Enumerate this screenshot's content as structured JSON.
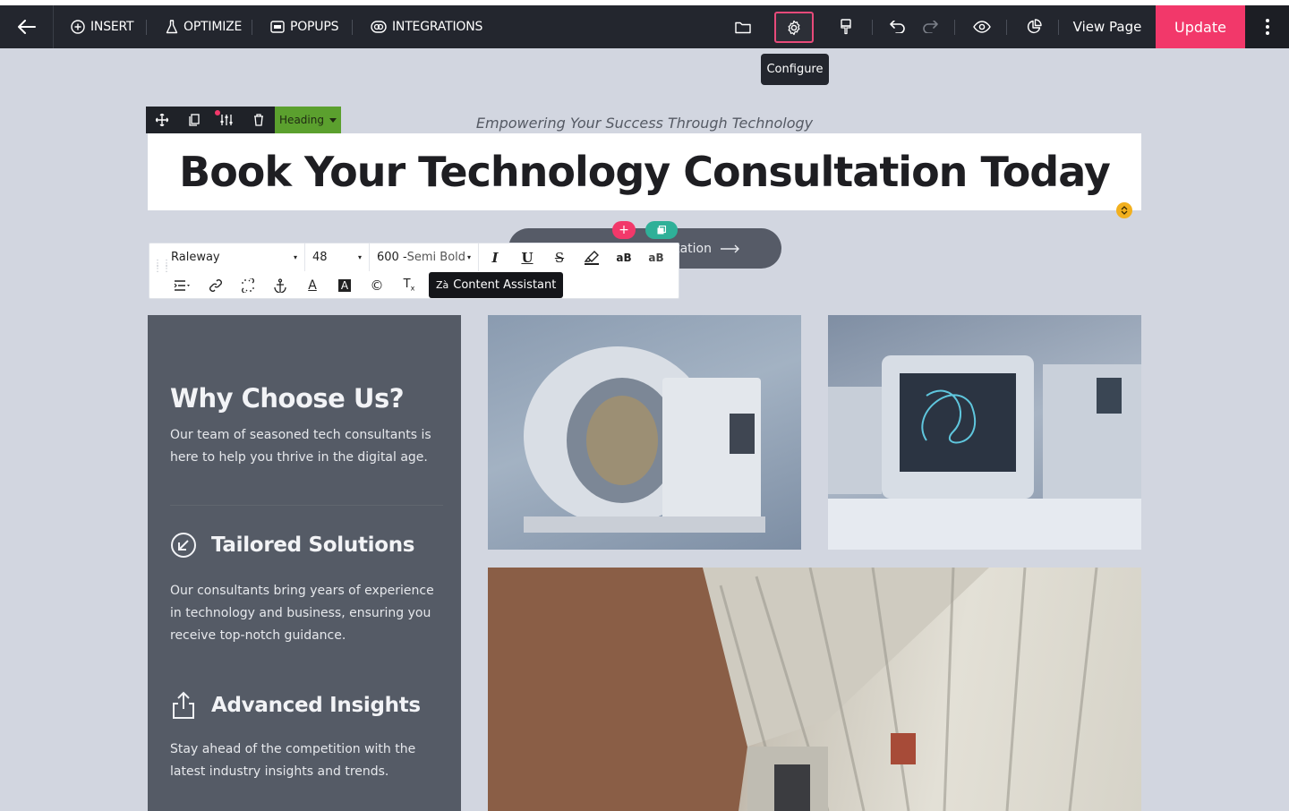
{
  "topbar": {
    "nav": [
      {
        "label": "INSERT",
        "icon": "plus-circle-icon"
      },
      {
        "label": "OPTIMIZE",
        "icon": "flask-icon"
      },
      {
        "label": "POPUPS",
        "icon": "popup-icon"
      },
      {
        "label": "INTEGRATIONS",
        "icon": "integrations-icon"
      }
    ],
    "view_page": "View Page",
    "update": "Update",
    "tooltip": "Configure"
  },
  "element_toolbar": {
    "type_label": "Heading"
  },
  "hero": {
    "subheading": "Empowering Your Success Through Technology",
    "heading": "Book Your Technology Consultation Today",
    "cta_visible_text": "tation"
  },
  "format_toolbar": {
    "font": "Raleway",
    "size": "48",
    "weight_num": "600 -",
    "weight_name": "Semi Bold",
    "content_assistant": "Content Assistant"
  },
  "panel": {
    "title": "Why Choose Us?",
    "intro": "Our team of seasoned tech consultants is here to help you thrive in the digital age.",
    "features": [
      {
        "title": "Tailored Solutions",
        "text": "Our consultants bring years of experience in technology and business, ensuring you receive top-notch guidance.",
        "icon": "arrow-down-left-circle-icon"
      },
      {
        "title": "Advanced Insights",
        "text": "Stay ahead of the competition with the latest industry insights and trends.",
        "icon": "share-icon"
      }
    ]
  },
  "colors": {
    "topbar": "#23262e",
    "update": "#f2386a",
    "heading_tag": "#5ba02e",
    "panel": "#555b66",
    "canvas": "#d2d6e0"
  }
}
